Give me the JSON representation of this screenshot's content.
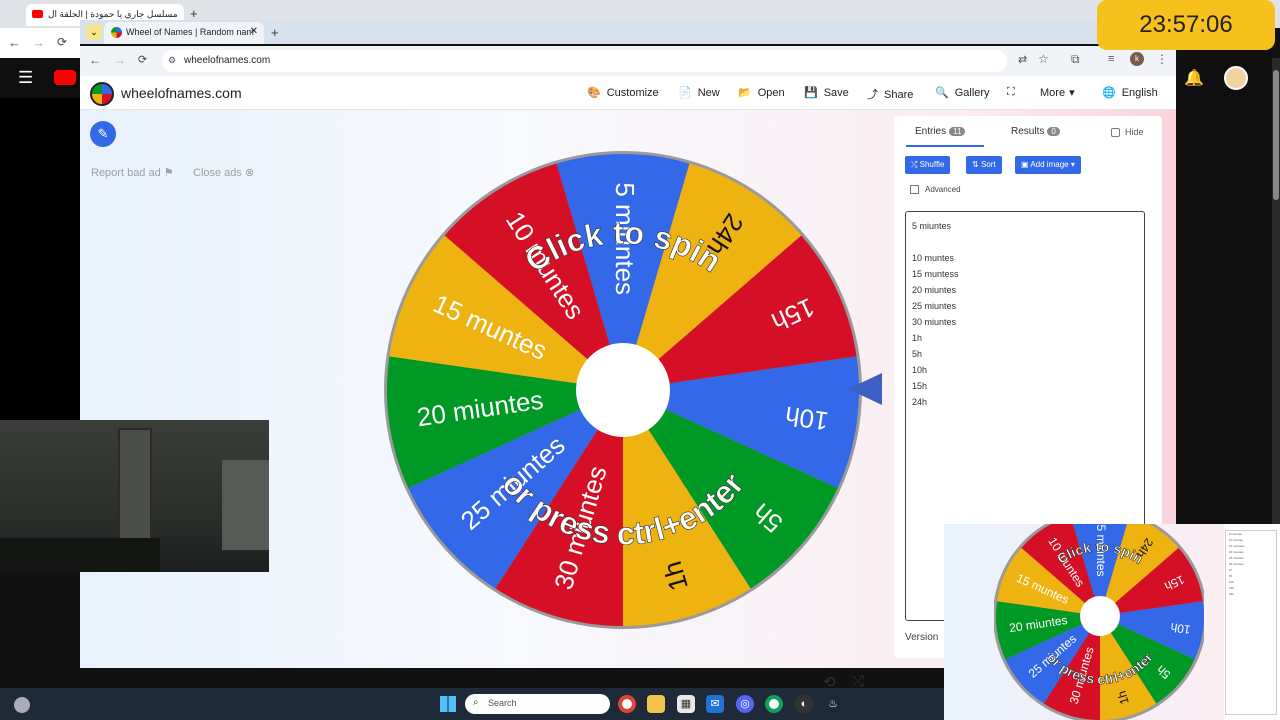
{
  "outer_browser": {
    "tab_title": "مسلسل جاري يا حمودة | الحلقة ال",
    "new_tab": "+"
  },
  "inner_browser": {
    "tab_title": "Wheel of Names | Random nam",
    "new_tab": "+",
    "url": "wheelofnames.com"
  },
  "site": {
    "name": "wheelofnames.com",
    "menu": [
      {
        "label": "Customize",
        "icon": "palette-icon",
        "glyph": "🎨"
      },
      {
        "label": "New",
        "icon": "file-icon",
        "glyph": "📄"
      },
      {
        "label": "Open",
        "icon": "folder-icon",
        "glyph": "📂"
      },
      {
        "label": "Save",
        "icon": "save-icon",
        "glyph": "💾"
      },
      {
        "label": "Share",
        "icon": "share-icon",
        "glyph": "⤴"
      },
      {
        "label": "Gallery",
        "icon": "search-icon",
        "glyph": "🔍"
      },
      {
        "label": "",
        "icon": "fullscreen-icon",
        "glyph": "⛶"
      },
      {
        "label": "More",
        "icon": "chevron-down-icon",
        "glyph": "▾"
      },
      {
        "label": "English",
        "icon": "globe-icon",
        "glyph": "🌐"
      }
    ],
    "report_bad_ad": "Report bad ad",
    "close_ads": "Close ads"
  },
  "wheel": {
    "slice_colors": [
      "#3369e8",
      "#eeb211",
      "#d50f25",
      "#3369e8",
      "#009925",
      "#eeb211",
      "#d50f25",
      "#3369e8",
      "#009925",
      "#eeb211",
      "#d50f25"
    ],
    "slices": [
      "5 miuntes",
      "24h",
      "15h",
      "10h",
      "5h",
      "1h",
      "30 miuntes",
      "25 miuntes",
      "20 miuntes",
      "15 muntes",
      "10 muntes"
    ],
    "top_text": "Click to spin",
    "bottom_text": "or press ctrl+enter"
  },
  "panel": {
    "tab_entries": "Entries",
    "entries_count": "11",
    "tab_results": "Results",
    "results_count": "0",
    "hide_label": "Hide",
    "shuffle_label": "Shuffle",
    "sort_label": "Sort",
    "add_image_label": "Add image",
    "advanced_label": "Advanced",
    "entries": [
      "5 miuntes",
      "",
      "10 muntes",
      "15 muntess",
      "20 miuntes",
      "25 miuntes",
      "30 miuntes",
      "1h",
      "5h",
      "10h",
      "15h",
      "24h"
    ],
    "version_label": "Version"
  },
  "taskbar": {
    "search_placeholder": "Search"
  },
  "clock": "23:57:06",
  "colors": {
    "accent_blue": "#3369e8",
    "yellow": "#eeb211",
    "red": "#d50f25",
    "green": "#009925",
    "clock_bg": "#f6c11c"
  }
}
